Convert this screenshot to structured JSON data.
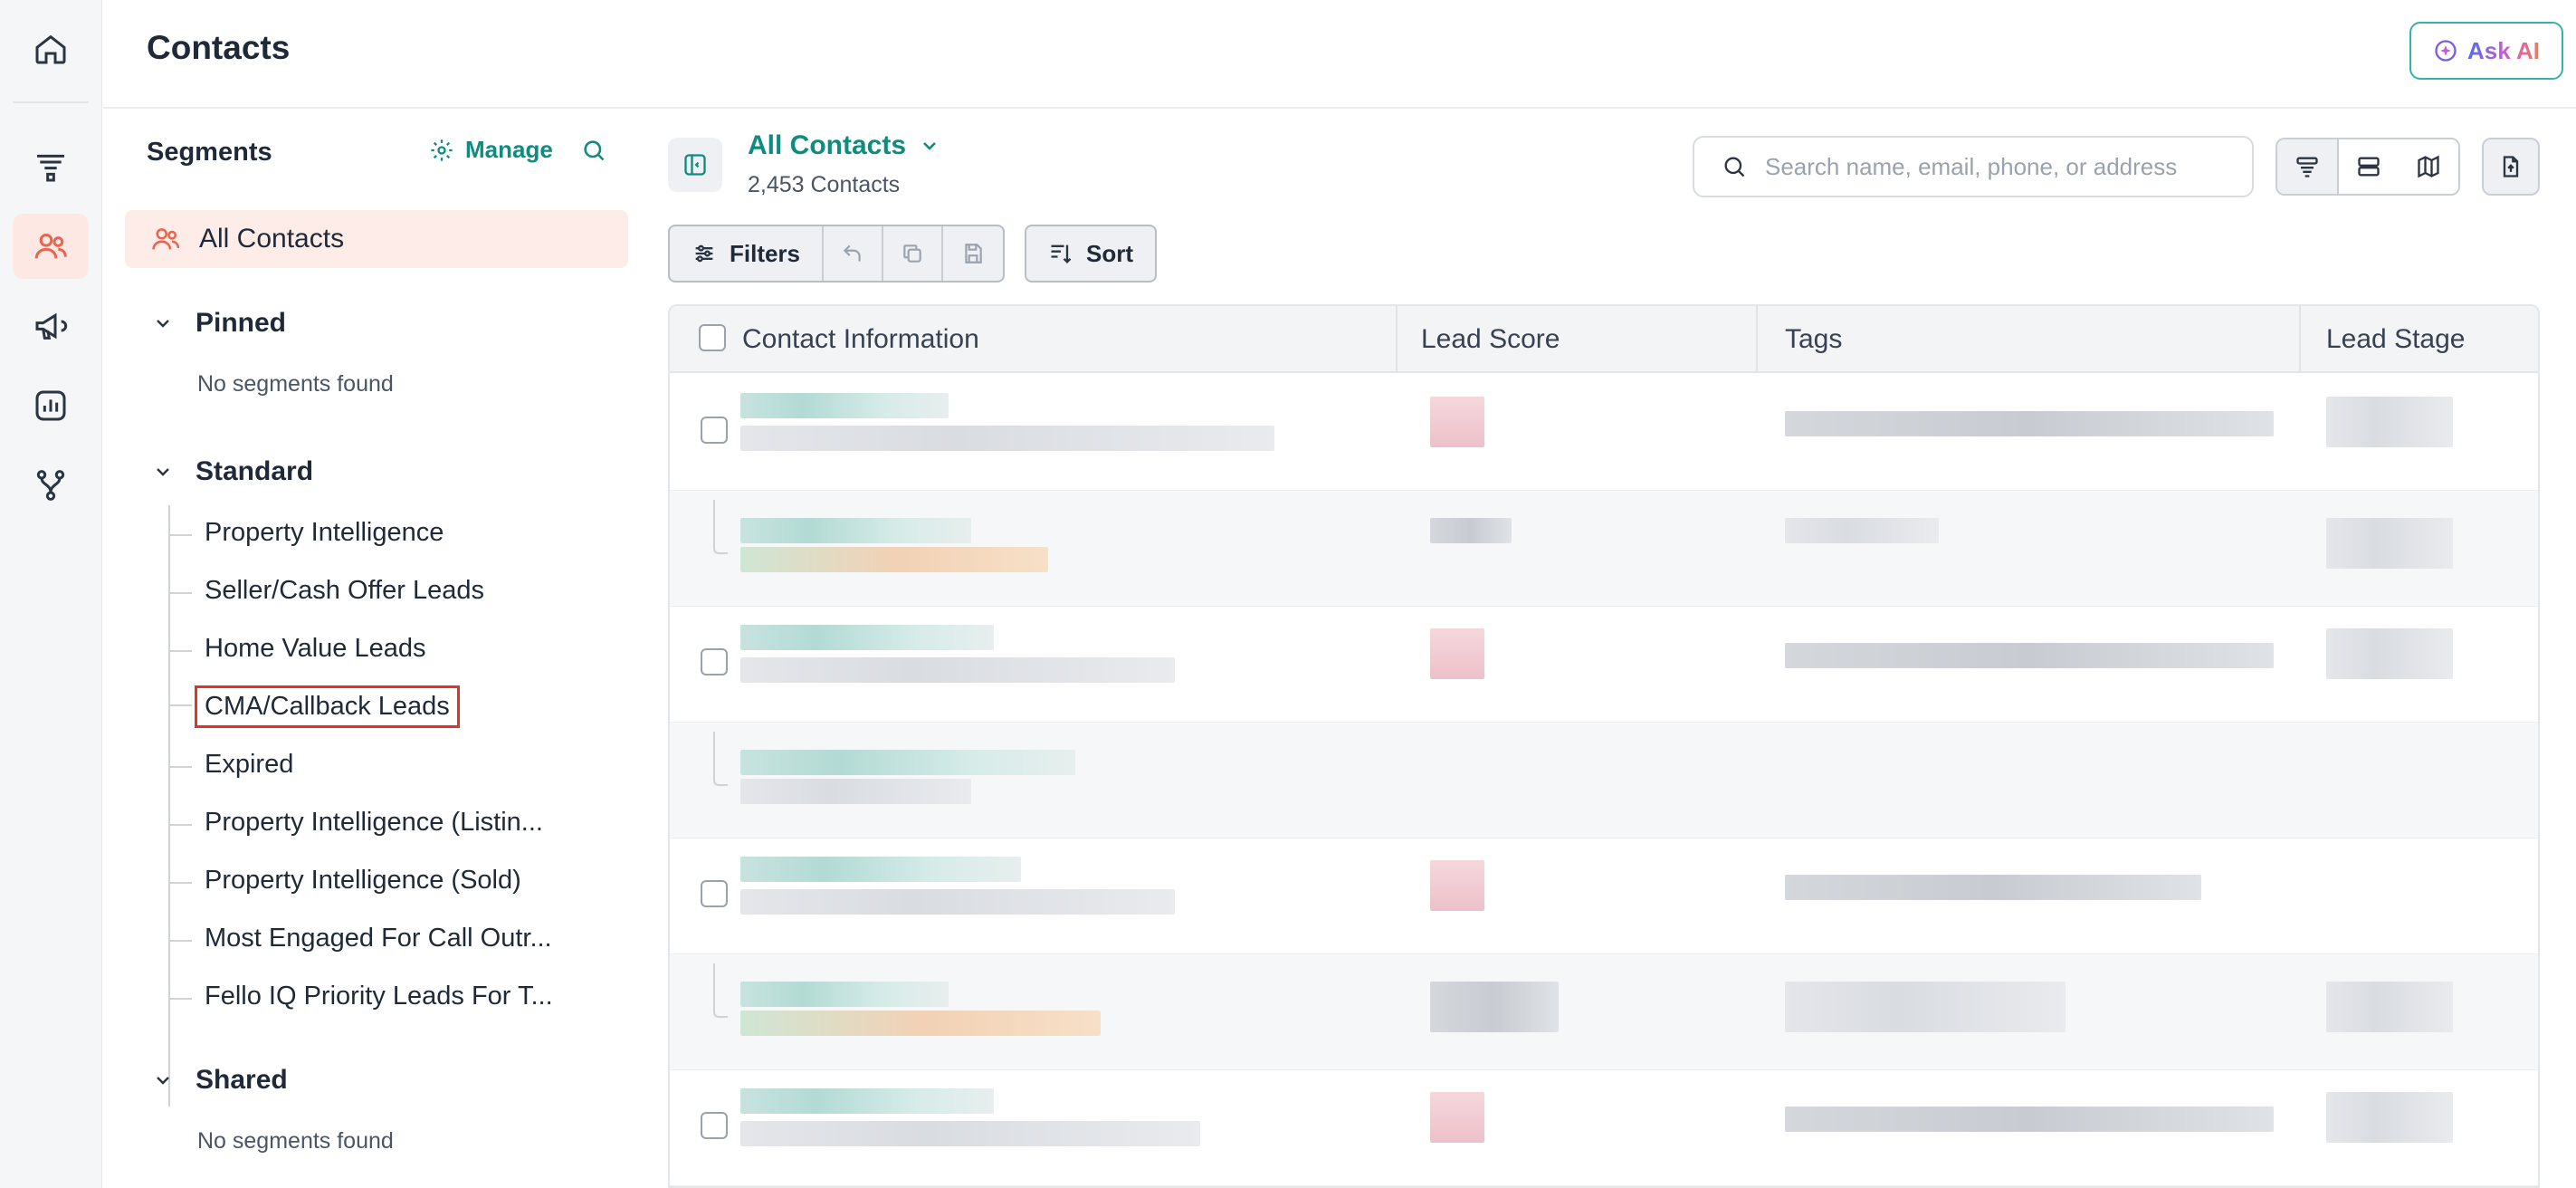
{
  "header": {
    "title": "Contacts",
    "ask_ai_label": "Ask AI"
  },
  "rail": {
    "items": [
      {
        "icon": "home-icon"
      },
      {
        "icon": "funnel-icon"
      },
      {
        "icon": "users-icon",
        "active": true
      },
      {
        "icon": "megaphone-icon"
      },
      {
        "icon": "chart-icon"
      },
      {
        "icon": "workflow-icon"
      }
    ]
  },
  "segments": {
    "title": "Segments",
    "manage_label": "Manage",
    "all_contacts": "All Contacts",
    "pinned": {
      "label": "Pinned",
      "empty": "No segments found"
    },
    "standard": {
      "label": "Standard",
      "items": [
        "Property Intelligence",
        "Seller/Cash Offer Leads",
        "Home Value Leads",
        "CMA/Callback Leads",
        "Expired",
        "Property Intelligence (Listin...",
        "Property Intelligence (Sold)",
        "Most Engaged For Call Outr...",
        "Fello IQ Priority Leads For T..."
      ],
      "highlighted_index": 3
    },
    "shared": {
      "label": "Shared",
      "empty": "No segments found"
    }
  },
  "main": {
    "view_name": "All Contacts",
    "view_count": "2,453 Contacts",
    "search_placeholder": "Search name, email, phone, or address",
    "filters_label": "Filters",
    "sort_label": "Sort"
  },
  "table": {
    "columns": [
      "Contact Information",
      "Lead Score",
      "Tags",
      "Lead Stage"
    ]
  },
  "colors": {
    "accent": "#0f8c80",
    "active_bg": "#fde8e4",
    "highlight_border": "#e0332a"
  }
}
